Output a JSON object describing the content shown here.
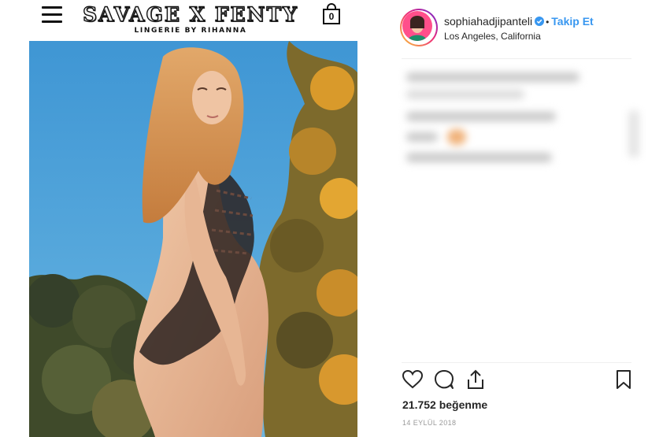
{
  "brand": {
    "name": "SAVAGE X FENTY",
    "tagline": "LINGERIE BY RIHANNA",
    "cart_count": "0"
  },
  "icons": {
    "menu": "hamburger-icon",
    "cart": "shopping-bag-icon",
    "verified": "verified-badge-icon",
    "like": "heart-icon",
    "comment": "comment-icon",
    "share": "share-icon",
    "save": "bookmark-icon"
  },
  "post": {
    "username": "sophiahadjipanteli",
    "separator": "•",
    "follow_label": "Takip Et",
    "location": "Los Angeles, California",
    "likes": "21.752 beğenme",
    "date": "14 EYLÜL 2018"
  },
  "colors": {
    "follow_blue": "#3897f0",
    "verified_blue": "#3897f0",
    "sky": "#4a9fd6"
  }
}
